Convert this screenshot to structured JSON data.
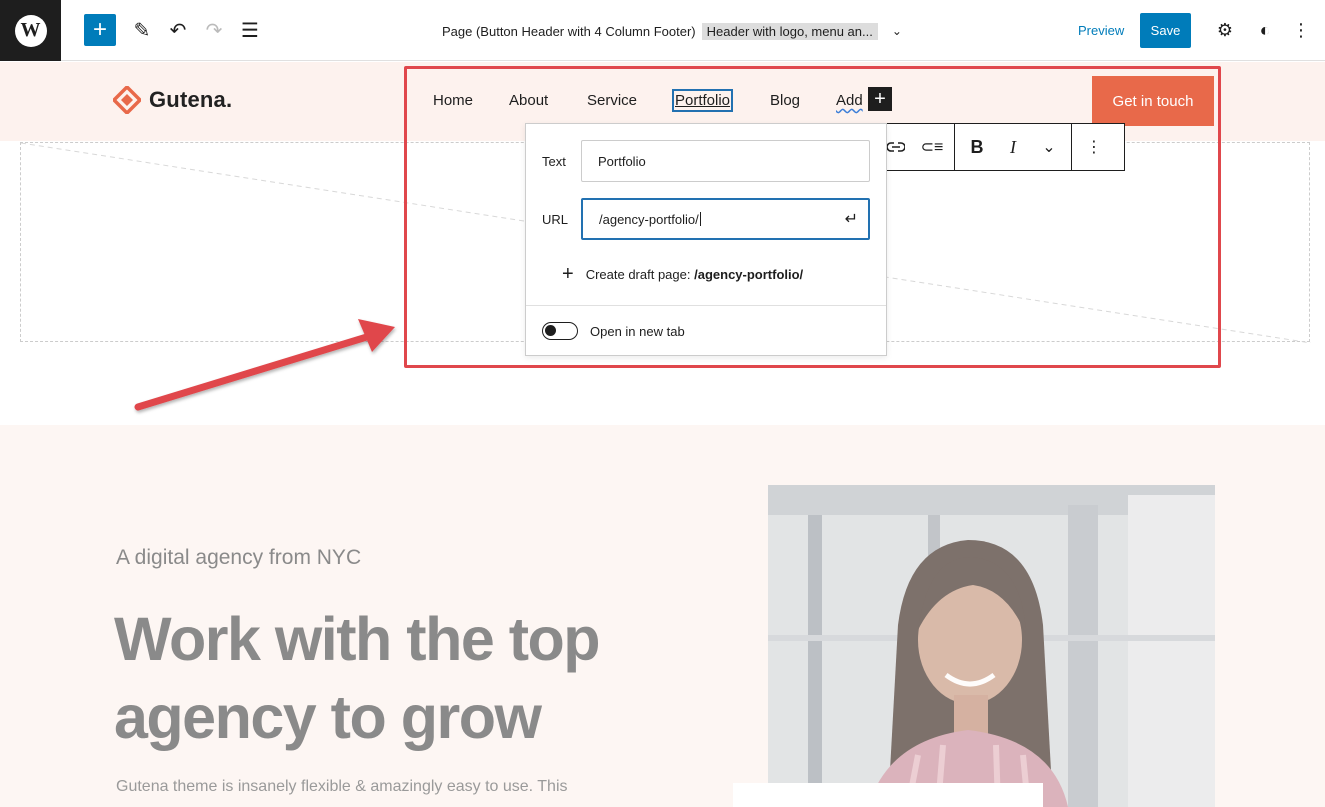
{
  "editor": {
    "wp_logo": "W",
    "add_icon": "+",
    "pencil_icon": "✎",
    "undo_icon": "↶",
    "redo_icon": "↷",
    "list_view_icon": "☰",
    "doc_title": "Page (Button Header with 4 Column Footer)",
    "template_part": "Header with logo, menu an...",
    "chevron": "⌄",
    "preview_label": "Preview",
    "save_label": "Save",
    "settings_icon": "⚙",
    "styles_icon": "◐",
    "more_icon": "⋮"
  },
  "site": {
    "logo_text": "Gutena.",
    "nav": [
      {
        "label": "Home"
      },
      {
        "label": "About"
      },
      {
        "label": "Service"
      },
      {
        "label": "Portfolio"
      },
      {
        "label": "Blog"
      },
      {
        "label": "Add"
      }
    ],
    "add_plus": "+",
    "cta_label": "Get in touch"
  },
  "format_toolbar": {
    "link_icon": "⊖",
    "list_icon": "⊂≡",
    "bold": "B",
    "italic": "I",
    "more_chevron": "⌄",
    "options": "⋮"
  },
  "link_popover": {
    "text_label": "Text",
    "text_value": "Portfolio",
    "url_label": "URL",
    "url_value": "/agency-portfolio/",
    "enter_icon": "↵",
    "create_prefix": "Create draft page:",
    "create_target": "/agency-portfolio/",
    "create_plus": "+",
    "new_tab_label": "Open in new tab",
    "new_tab_enabled": false
  },
  "hero": {
    "kicker": "A digital agency from NYC",
    "title": "Work with the top agency to grow",
    "description": "Gutena theme is insanely flexible & amazingly easy to use. This"
  },
  "colors": {
    "wp_blue": "#007cba",
    "cta_orange": "#e8694a",
    "header_bg": "#fdf2ee",
    "highlight_red": "#e0474c"
  }
}
